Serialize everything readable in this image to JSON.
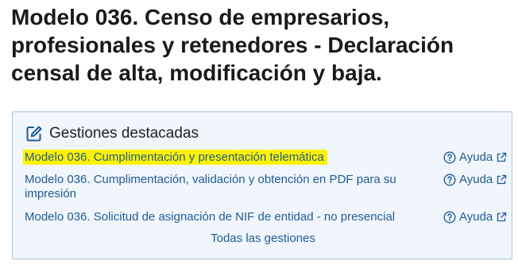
{
  "page": {
    "title": "Modelo 036. Censo de empresarios, profesionales y retenedores - Declaración censal de alta, modificación y baja."
  },
  "panel": {
    "title": "Gestiones destacadas",
    "items": [
      {
        "label": "Modelo 036. Cumplimentación y presentación telemática",
        "help": "Ayuda",
        "highlighted": true
      },
      {
        "label": "Modelo 036. Cumplimentación, validación y obtención en PDF para su impresión",
        "help": "Ayuda",
        "highlighted": false
      },
      {
        "label": "Modelo 036. Solicitud de asignación de NIF de entidad - no presencial",
        "help": "Ayuda",
        "highlighted": false
      }
    ],
    "all_link": "Todas las gestiones"
  },
  "colors": {
    "link": "#1f5b95",
    "highlight": "#fff200",
    "panel_bg": "#f0f6fb",
    "panel_border": "#a8c4dc"
  },
  "icons": {
    "header": "edit-icon",
    "help": "question-circle-icon",
    "external": "external-link-icon"
  }
}
